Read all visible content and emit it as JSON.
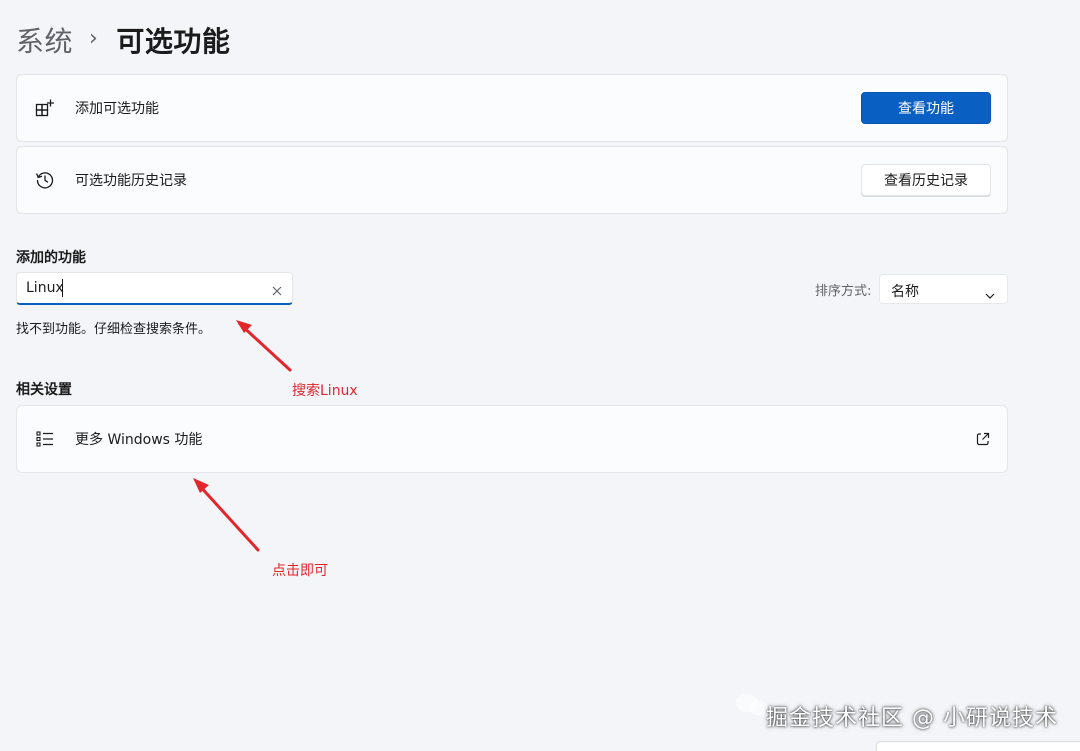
{
  "breadcrumb": {
    "parent": "系统",
    "separator": "›",
    "current": "可选功能"
  },
  "cards": {
    "add": {
      "icon": "add-apps-icon",
      "label": "添加可选功能",
      "button": "查看功能"
    },
    "history": {
      "icon": "history-icon",
      "label": "可选功能历史记录",
      "button": "查看历史记录"
    }
  },
  "added_features": {
    "heading": "添加的功能",
    "search": {
      "value": "Linux",
      "clear_icon": "close-icon"
    },
    "empty_message": "找不到功能。仔细检查搜索条件。",
    "sort": {
      "label": "排序方式:",
      "selected": "名称",
      "icon": "chevron-down-icon"
    }
  },
  "related": {
    "heading": "相关设置",
    "item": {
      "icon": "list-icon",
      "label": "更多 Windows 功能",
      "trailing_icon": "open-external-icon"
    }
  },
  "annotations": {
    "search": "搜索Linux",
    "click": "点击即可",
    "color": "#e3262b"
  },
  "watermark": {
    "text": "掘金技术社区 @ 小研说技术"
  },
  "colors": {
    "accent": "#0a5fc2",
    "background": "#f3f5f9",
    "card": "#fbfcfe"
  }
}
